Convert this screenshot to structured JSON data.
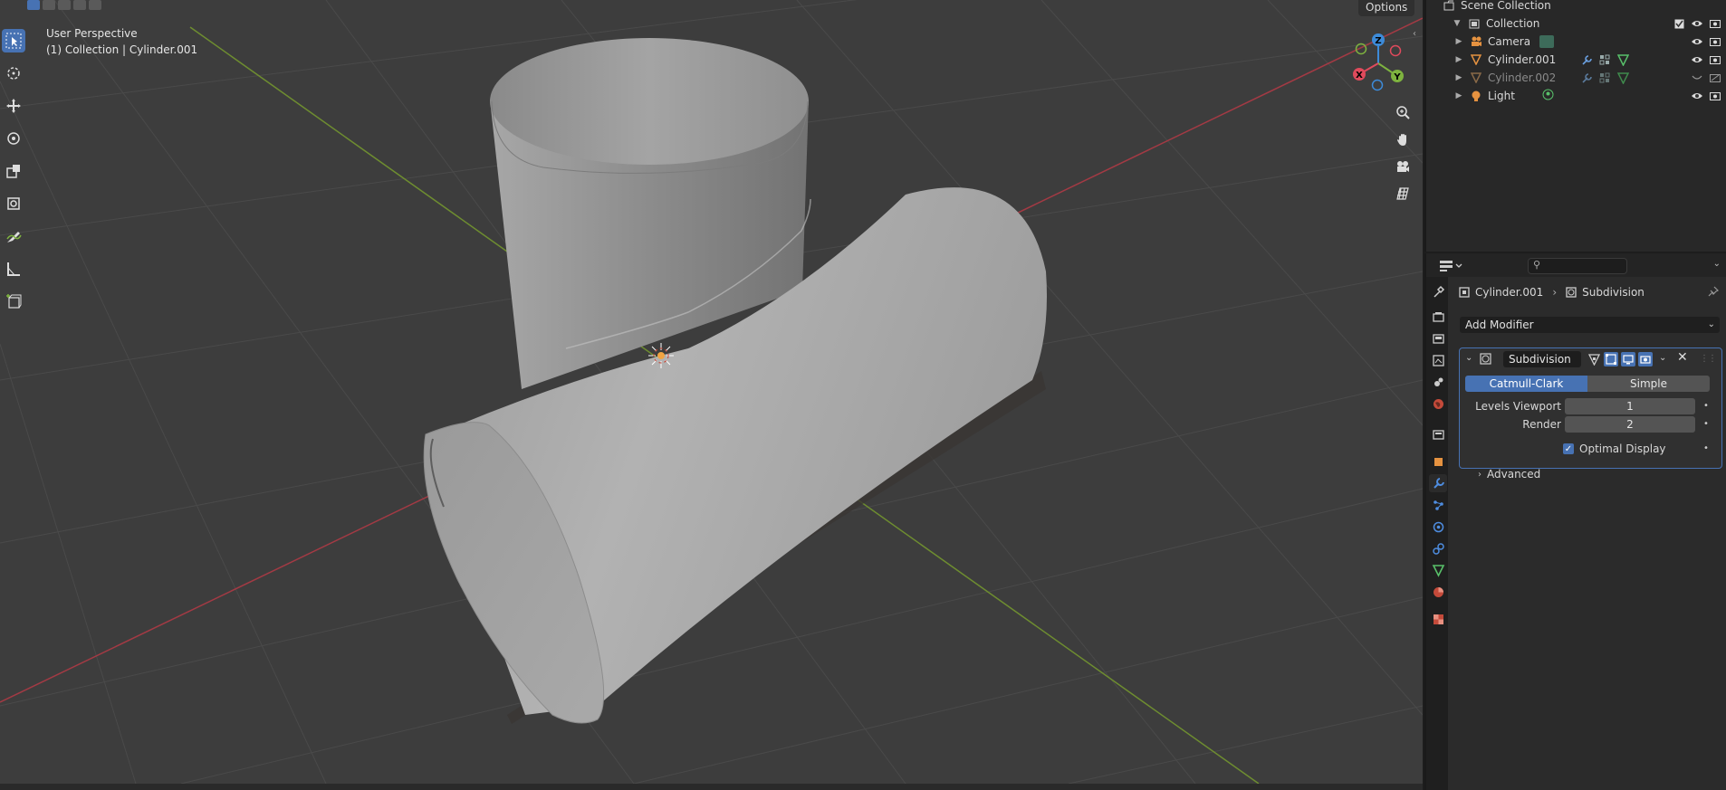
{
  "viewport": {
    "perspective_label": "User Perspective",
    "context_label": "(1) Collection | Cylinder.001",
    "options_label": "Options",
    "gizmo": {
      "z": "Z",
      "y": "Y",
      "x": "X"
    }
  },
  "tools": [
    "select-box",
    "cursor",
    "move",
    "rotate",
    "scale",
    "transform",
    "annotate",
    "measure",
    "add-cube"
  ],
  "outliner": {
    "scene_collection": "Scene Collection",
    "collection": "Collection",
    "items": [
      {
        "name": "Camera"
      },
      {
        "name": "Cylinder.001"
      },
      {
        "name": "Cylinder.002"
      },
      {
        "name": "Light"
      }
    ]
  },
  "properties": {
    "breadcrumb": {
      "object": "Cylinder.001",
      "modifier": "Subdivision"
    },
    "add_modifier": "Add Modifier",
    "modifier": {
      "name": "Subdivision",
      "type_options": [
        "Catmull-Clark",
        "Simple"
      ],
      "selected_type": "Catmull-Clark",
      "levels_viewport_label": "Levels Viewport",
      "levels_viewport": "1",
      "render_label": "Render",
      "render": "2",
      "optimal_display_label": "Optimal Display",
      "optimal_display": true,
      "advanced_label": "Advanced"
    }
  },
  "colors": {
    "accent": "#4772b3",
    "x_axis": "#e04a5c",
    "y_axis": "#7eb33f",
    "z_axis": "#3d8bd9"
  }
}
